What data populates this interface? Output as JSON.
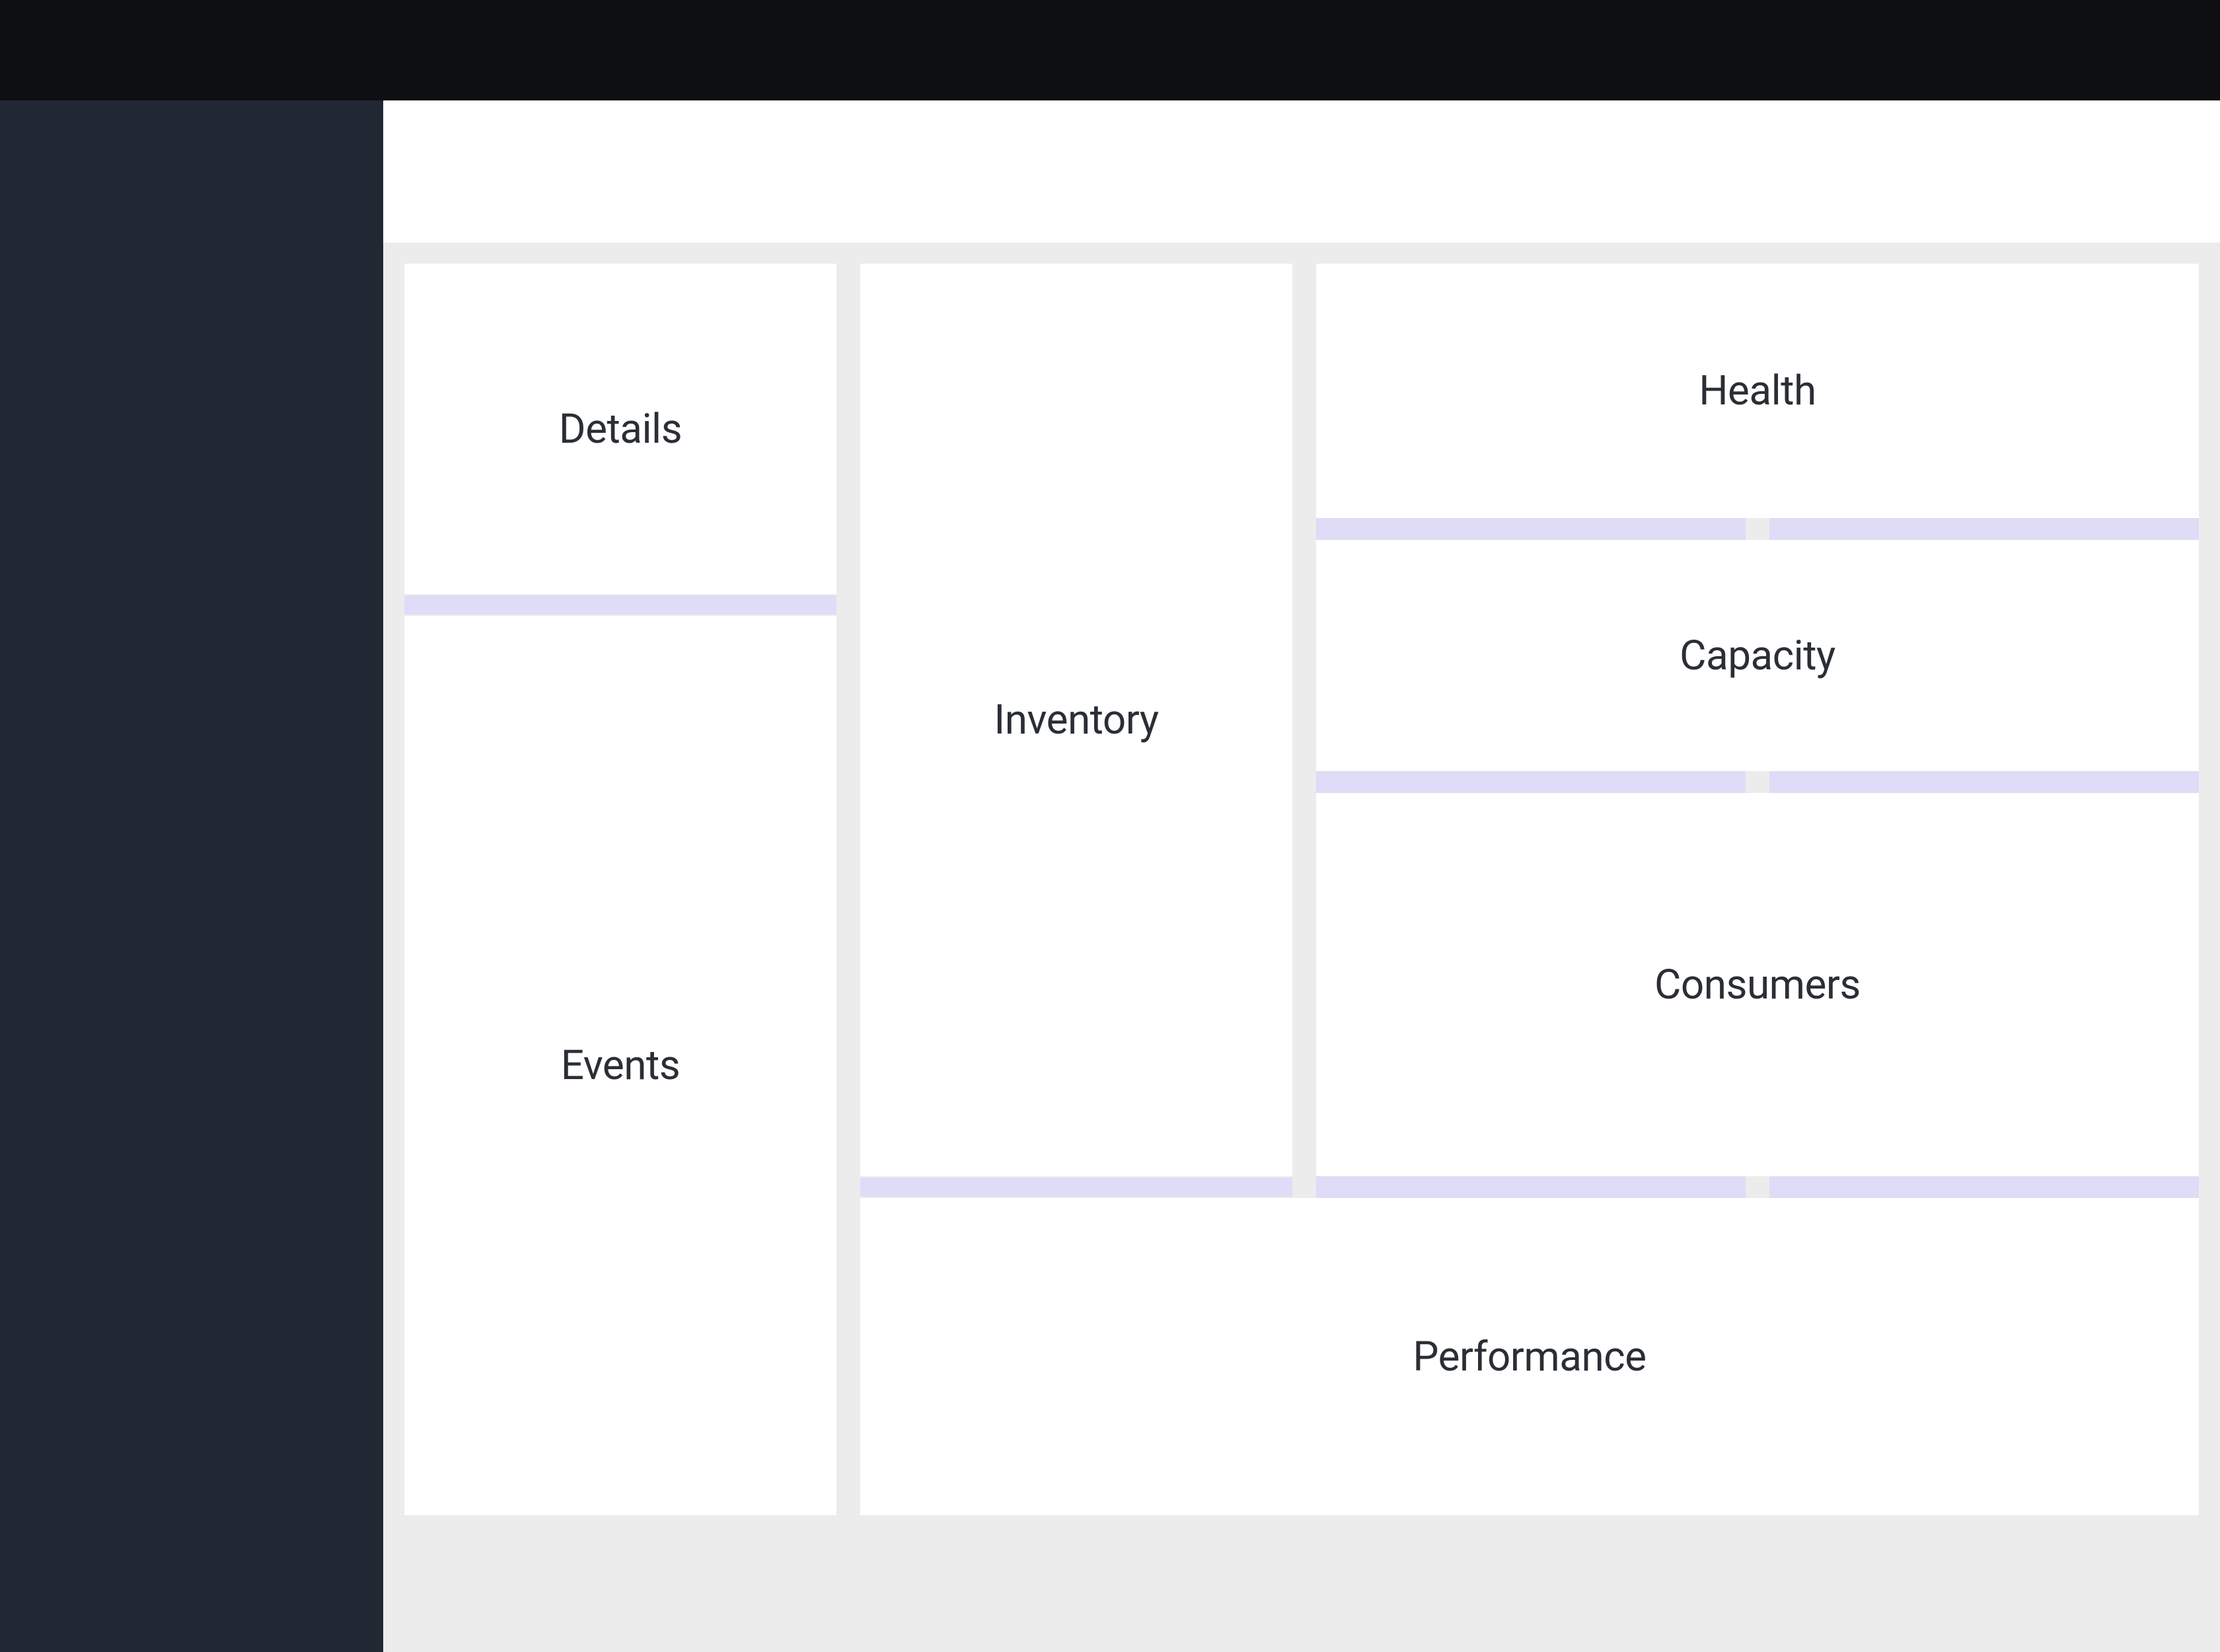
{
  "dashboard": {
    "panels": {
      "details": "Details",
      "events": "Events",
      "inventory": "Inventory",
      "health": "Health",
      "capacity": "Capacity",
      "consumers": "Consumers",
      "performance": "Performance"
    }
  },
  "colors": {
    "topbar": "#0e0f13",
    "sidebar": "#212733",
    "canvas": "#ececec",
    "panel": "#ffffff",
    "drop_gap": "#dedcf6",
    "text": "#2a2e35"
  }
}
